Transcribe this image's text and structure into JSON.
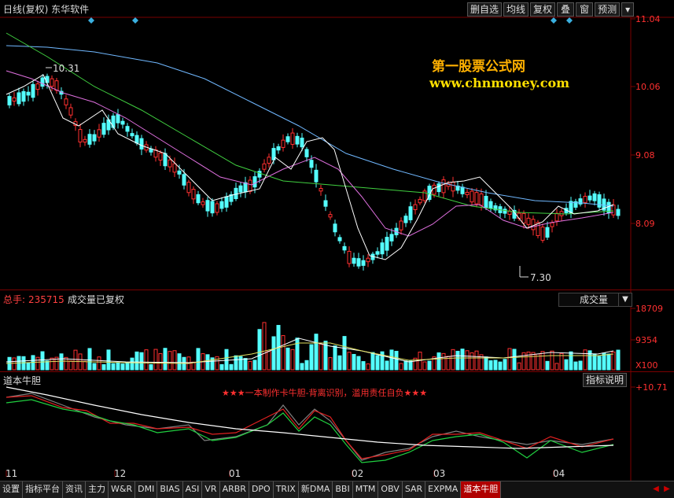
{
  "window": {
    "title": "日线(复权)  东华软件",
    "toolbar": [
      "删自选",
      "均线",
      "复权",
      "叠",
      "窗",
      "预测"
    ]
  },
  "price_panel": {
    "axis_labels": [
      "11.04",
      "10.06",
      "9.08",
      "8.09"
    ],
    "high_annotation": "10.31",
    "low_annotation": "7.30",
    "watermark_title": "第一股票公式网",
    "watermark_url": "www.chnmoney.com"
  },
  "volume_panel": {
    "total_label": "总手: ",
    "total_value": "235715",
    "note": "成交量已复权",
    "dropdown_value": "成交量",
    "axis_labels": [
      "18709",
      "9354",
      "X100"
    ]
  },
  "indicator_panel": {
    "name": "道本牛胆",
    "help_button": "指标说明",
    "banner": "★★★一本制作卡牛胆-背离识别，滥用责任自负★★★",
    "axis_label": "+10.71"
  },
  "x_axis": [
    "11",
    "12",
    "01",
    "02",
    "03",
    "04"
  ],
  "tabs": [
    "设置",
    "指标平台",
    "资讯",
    "主力",
    "W&R",
    "DMI",
    "BIAS",
    "ASI",
    "VR",
    "ARBR",
    "DPO",
    "TRIX",
    "新DMA",
    "BBI",
    "MTM",
    "OBV",
    "SAR",
    "EXPMA",
    "道本牛胆"
  ],
  "active_tab": "道本牛胆",
  "colors": {
    "up": "#ff3030",
    "down": "#54ffff",
    "frame": "#7a0000"
  }
}
